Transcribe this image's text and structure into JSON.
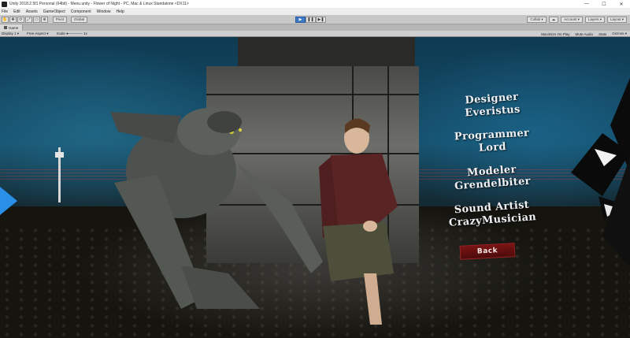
{
  "window": {
    "title": "Unity 2018.2.5f1 Personal (64bit) - Menu.unity - Flower of Night - PC, Mac & Linux Standalone <DX11>",
    "minimize": "—",
    "maximize": "☐",
    "close": "✕"
  },
  "menu": [
    "File",
    "Edit",
    "Assets",
    "GameObject",
    "Component",
    "Window",
    "Help"
  ],
  "toolbar": {
    "tools": [
      "✋",
      "✥",
      "⟳",
      "⤢",
      "▭",
      "⊕"
    ],
    "pivot": "Pivot",
    "global": "Global",
    "play": "▶",
    "pause": "❚❚",
    "step": "▶❚",
    "right": [
      "Collab ▾",
      "☁",
      "Account ▾",
      "Layers ▾",
      "Layout ▾"
    ]
  },
  "game_tab": {
    "label": "Game"
  },
  "gamebar": {
    "display": "Display 1 ▾",
    "aspect": "Free Aspect ▾",
    "scale": "Scale ●———— 1x",
    "right": [
      "Maximize On Play",
      "Mute Audio",
      "Stats",
      "Gizmos ▾"
    ]
  },
  "credits": [
    {
      "role": "Designer",
      "name": "Everistus"
    },
    {
      "role": "Programmer",
      "name": "Lord"
    },
    {
      "role": "Modeler",
      "name": "Grendelbiter"
    },
    {
      "role": "Sound Artist",
      "name": "CrazyMusician"
    }
  ],
  "back_label": "Back",
  "colors": {
    "play_active": "#3c79c6",
    "back_button": "#7a1414",
    "left_arrow": "#2a8fe6"
  }
}
